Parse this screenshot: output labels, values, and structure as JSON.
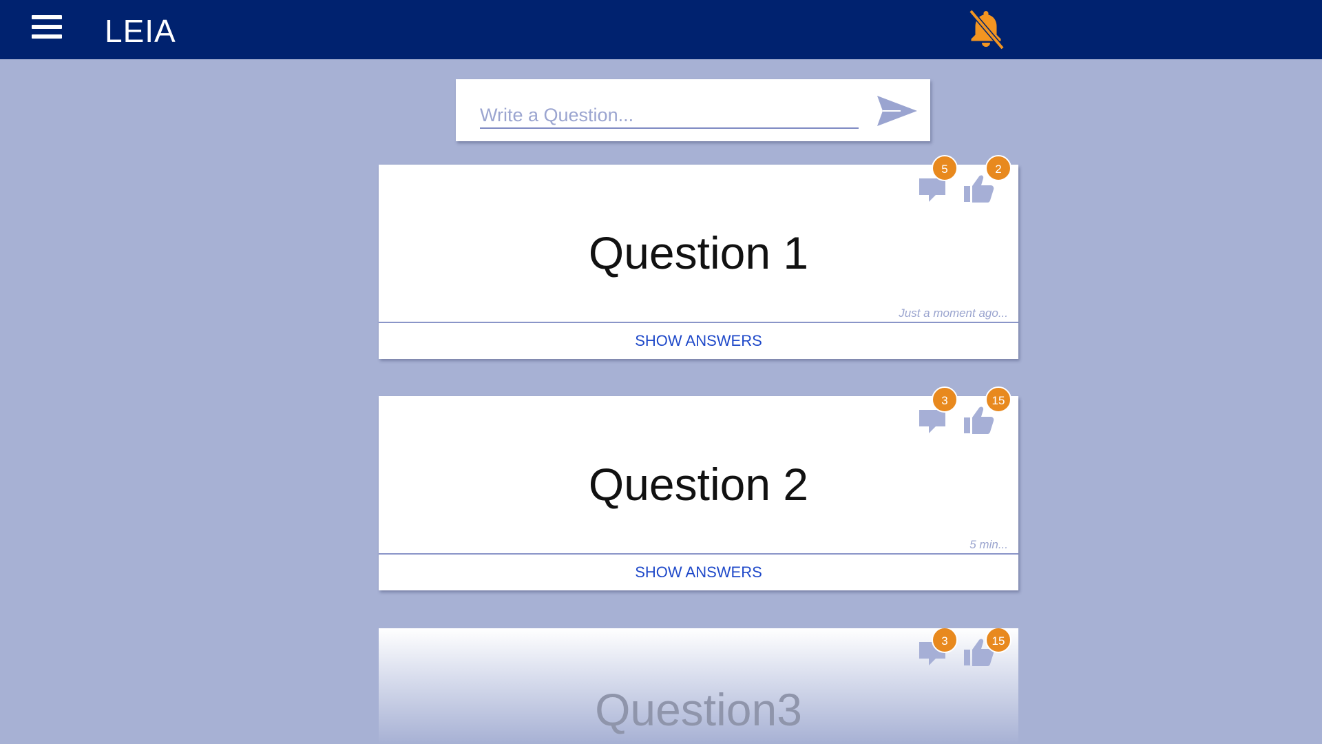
{
  "header": {
    "app_title": "LEIA",
    "menu_icon": "hamburger-menu-icon",
    "notifications_icon": "bell-off-icon",
    "accent_color": "#e8891e",
    "bar_color": "#00226f"
  },
  "composer": {
    "placeholder": "Write a Question...",
    "send_icon": "send-icon"
  },
  "questions": [
    {
      "title": "Question 1",
      "comments": "5",
      "likes": "2",
      "time": "Just a moment ago...",
      "action": "SHOW ANSWERS"
    },
    {
      "title": "Question 2",
      "comments": "3",
      "likes": "15",
      "time": "5 min...",
      "action": "SHOW ANSWERS"
    },
    {
      "title": "Question3",
      "comments": "3",
      "likes": "15"
    }
  ]
}
